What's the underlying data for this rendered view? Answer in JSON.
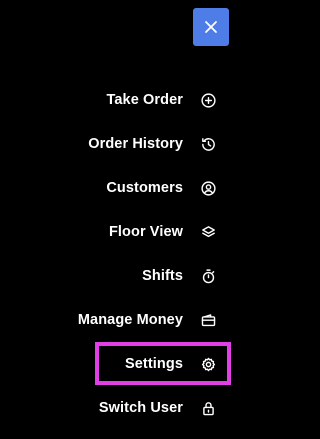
{
  "close_button": {
    "icon": "close-icon",
    "color": "#4f7de8"
  },
  "menu": {
    "items": [
      {
        "label": "Take Order",
        "icon": "plus-circle-icon"
      },
      {
        "label": "Order History",
        "icon": "history-icon"
      },
      {
        "label": "Customers",
        "icon": "user-circle-icon"
      },
      {
        "label": "Floor View",
        "icon": "layers-icon"
      },
      {
        "label": "Shifts",
        "icon": "stopwatch-icon"
      },
      {
        "label": "Manage Money",
        "icon": "wallet-icon"
      },
      {
        "label": "Settings",
        "icon": "gear-icon",
        "highlighted": true
      },
      {
        "label": "Switch User",
        "icon": "lock-icon"
      }
    ]
  },
  "highlight_color": "#e040e6"
}
